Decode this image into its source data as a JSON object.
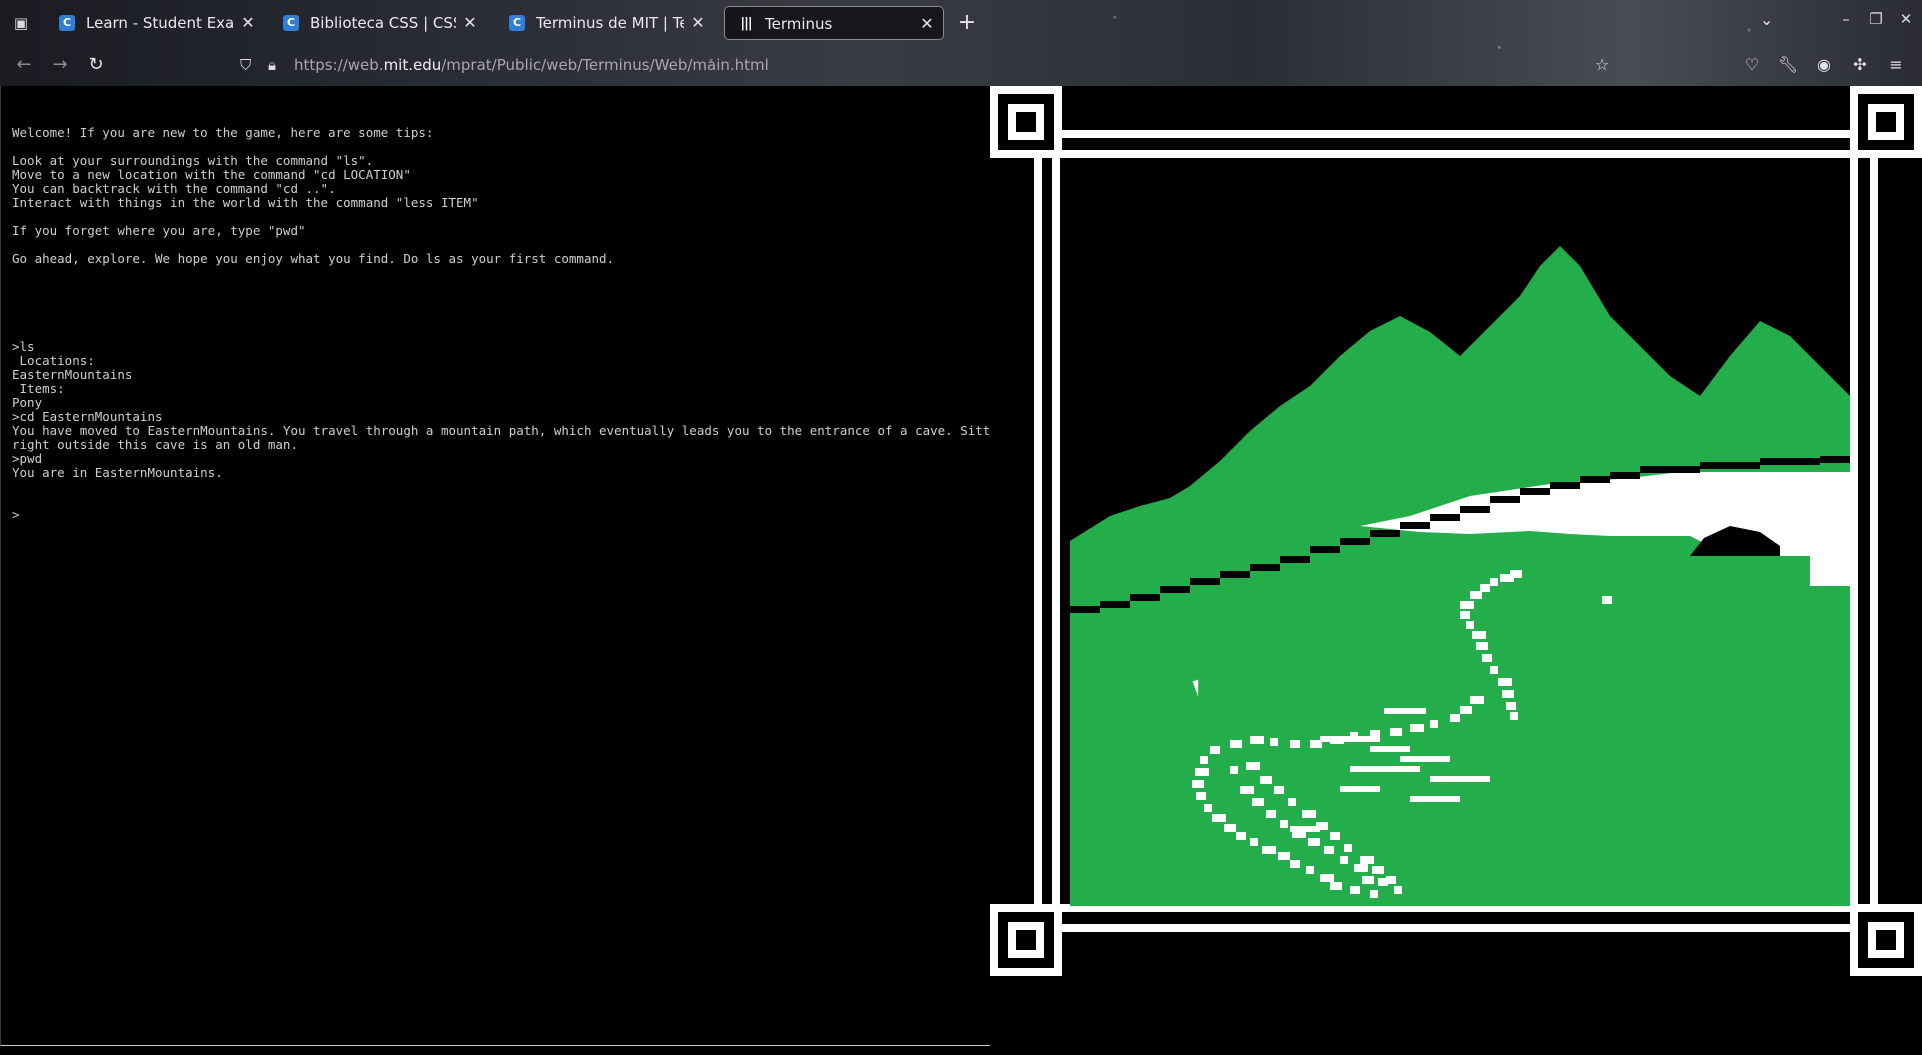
{
  "browser": {
    "tabs": [
      {
        "label": "Learn - Student Exams",
        "active": false,
        "favicon": "codecademy-icon"
      },
      {
        "label": "Biblioteca CSS | CSS Extras",
        "active": false,
        "favicon": "codecademy-icon"
      },
      {
        "label": "Terminus de MIT | Terminus",
        "active": false,
        "favicon": "codecademy-icon"
      },
      {
        "label": "Terminus",
        "active": true,
        "favicon": "bars-icon"
      }
    ],
    "url_prefix": "https://web.",
    "url_host": "mit.edu",
    "url_path": "/mprat/Public/web/Terminus/Web/main.html",
    "accent": "#1eb44a"
  },
  "terminal": {
    "intro": [
      "Welcome! If you are new to the game, here are some tips:",
      "",
      "Look at your surroundings with the command \"ls\".",
      "Move to a new location with the command \"cd LOCATION\"",
      "You can backtrack with the command \"cd ..\".",
      "Interact with things in the world with the command \"less ITEM\"",
      "",
      "If you forget where you are, type \"pwd\"",
      "",
      "Go ahead, explore. We hope you enjoy what you find. Do ls as your first command.",
      ""
    ],
    "session": [
      ">ls",
      " Locations:",
      "EasternMountains",
      " Items:",
      "Pony",
      ">cd EasternMountains",
      "You have moved to EasternMountains. You travel through a mountain path, which eventually leads you to the entrance of a cave. Sitting",
      "right outside this cave is an old man.",
      ">pwd",
      "You are in EasternMountains."
    ],
    "prompt": ">",
    "text_color": "#cfcfcf"
  },
  "scene": {
    "location": "EasternMountains",
    "grass_color": "#23ae4b",
    "frame_color": "#ffffff"
  }
}
